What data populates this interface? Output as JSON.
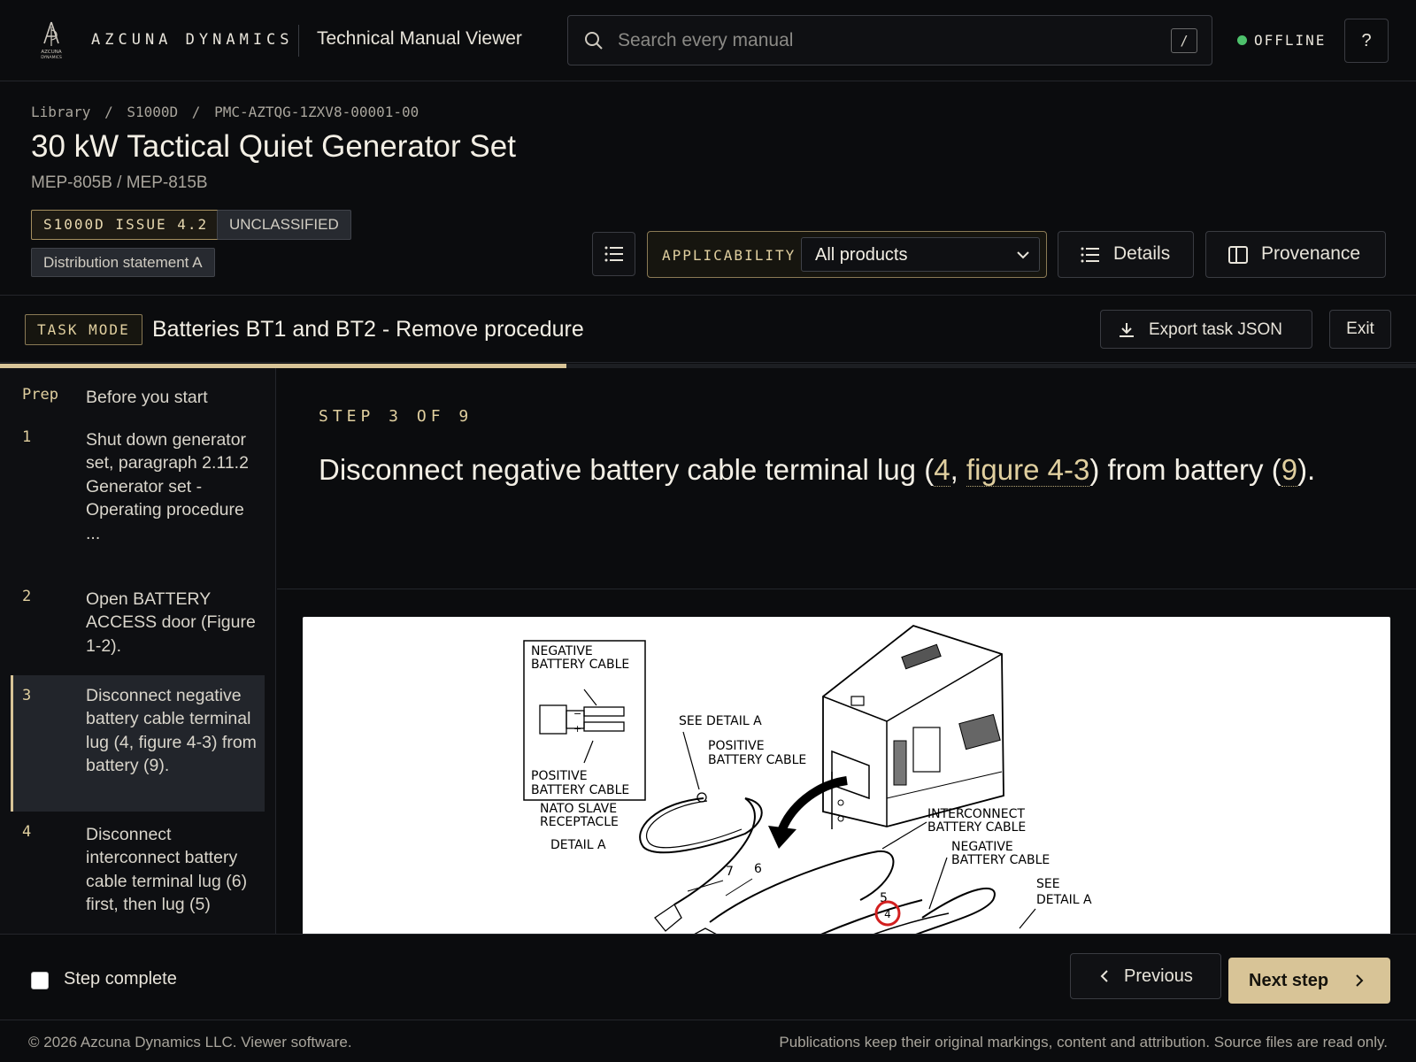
{
  "brand": {
    "name": "AZCUNA DYNAMICS",
    "logo_text_1": "AZCUNA",
    "logo_text_2": "DYNAMICS",
    "app_title": "Technical Manual Viewer"
  },
  "search": {
    "placeholder": "Search every manual",
    "value": "",
    "shortcut": "/"
  },
  "status": {
    "text": "OFFLINE",
    "color": "#4ec26c"
  },
  "help": {
    "label": "?"
  },
  "breadcrumb": [
    "Library",
    "/",
    "S1000D",
    "/",
    "PMC-AZTQG-1ZXV8-00001-00"
  ],
  "document": {
    "title": "30 kW Tactical Quiet Generator Set",
    "subtitle": "MEP-805B / MEP-815B",
    "tags": {
      "issue": "S1000D ISSUE 4.2",
      "classification": "UNCLASSIFIED",
      "distribution": "Distribution statement A"
    }
  },
  "toolbar": {
    "toc_icon": "list-icon",
    "applicability_label": "APPLICABILITY",
    "applicability_value": "All products",
    "details_label": "Details",
    "provenance_label": "Provenance"
  },
  "task": {
    "mode_label": "TASK MODE",
    "title": "Batteries BT1 and BT2 - Remove procedure",
    "export_label": "Export task JSON",
    "exit_label": "Exit",
    "progress_fraction": 0.4
  },
  "steps": [
    {
      "num": "Prep",
      "label": "Before you start"
    },
    {
      "num": "1",
      "label": "Shut down generator set, paragraph 2.11.2 Generator set - Operating procedure ..."
    },
    {
      "num": "2",
      "label": "Open BATTERY ACCESS door (Figure 1-2)."
    },
    {
      "num": "3",
      "label": "Disconnect negative battery cable terminal lug (4, figure 4-3) from battery (9).",
      "active": true
    },
    {
      "num": "4",
      "label": "Disconnect interconnect battery cable terminal lug (6) first, then lug (5)"
    }
  ],
  "current_step": {
    "kicker": "STEP 3 OF 9",
    "text_before": "Disconnect negative battery cable terminal lug (",
    "ref_item": "4",
    "text_comma": ", ",
    "ref_figure": "figure 4-3",
    "text_mid": ") from battery (",
    "ref_battery": "9",
    "text_end": ")."
  },
  "figure": {
    "labels": {
      "neg_cable_1": "NEGATIVE",
      "neg_cable_2": "BATTERY  CABLE",
      "pos_cable_1": "POSITIVE",
      "pos_cable_2": "BATTERY  CABLE",
      "nato_1": "NATO  SLAVE",
      "nato_2": "RECEPTACLE",
      "detail_a": "DETAIL  A",
      "see_detail": "SEE  DETAIL  A",
      "pos_cable_b1": "POSITIVE",
      "pos_cable_b2": "BATTERY  CABLE",
      "inter_1": "INTERCONNECT",
      "inter_2": "BATTERY  CABLE",
      "neg_cable_b1": "NEGATIVE",
      "neg_cable_b2": "BATTERY  CABLE",
      "see_2": "SEE",
      "detail_2": "DETAIL  A",
      "n7": "7",
      "n6": "6",
      "n5": "5",
      "n4": "4"
    },
    "highlight_color": "#d21f1f"
  },
  "actions": {
    "step_complete_label": "Step complete",
    "previous_label": "Previous",
    "next_label": "Next step"
  },
  "footer": {
    "left": "© 2026 Azcuna Dynamics LLC. Viewer software.",
    "right": "Publications keep their original markings, content and attribution. Source files are read only."
  }
}
